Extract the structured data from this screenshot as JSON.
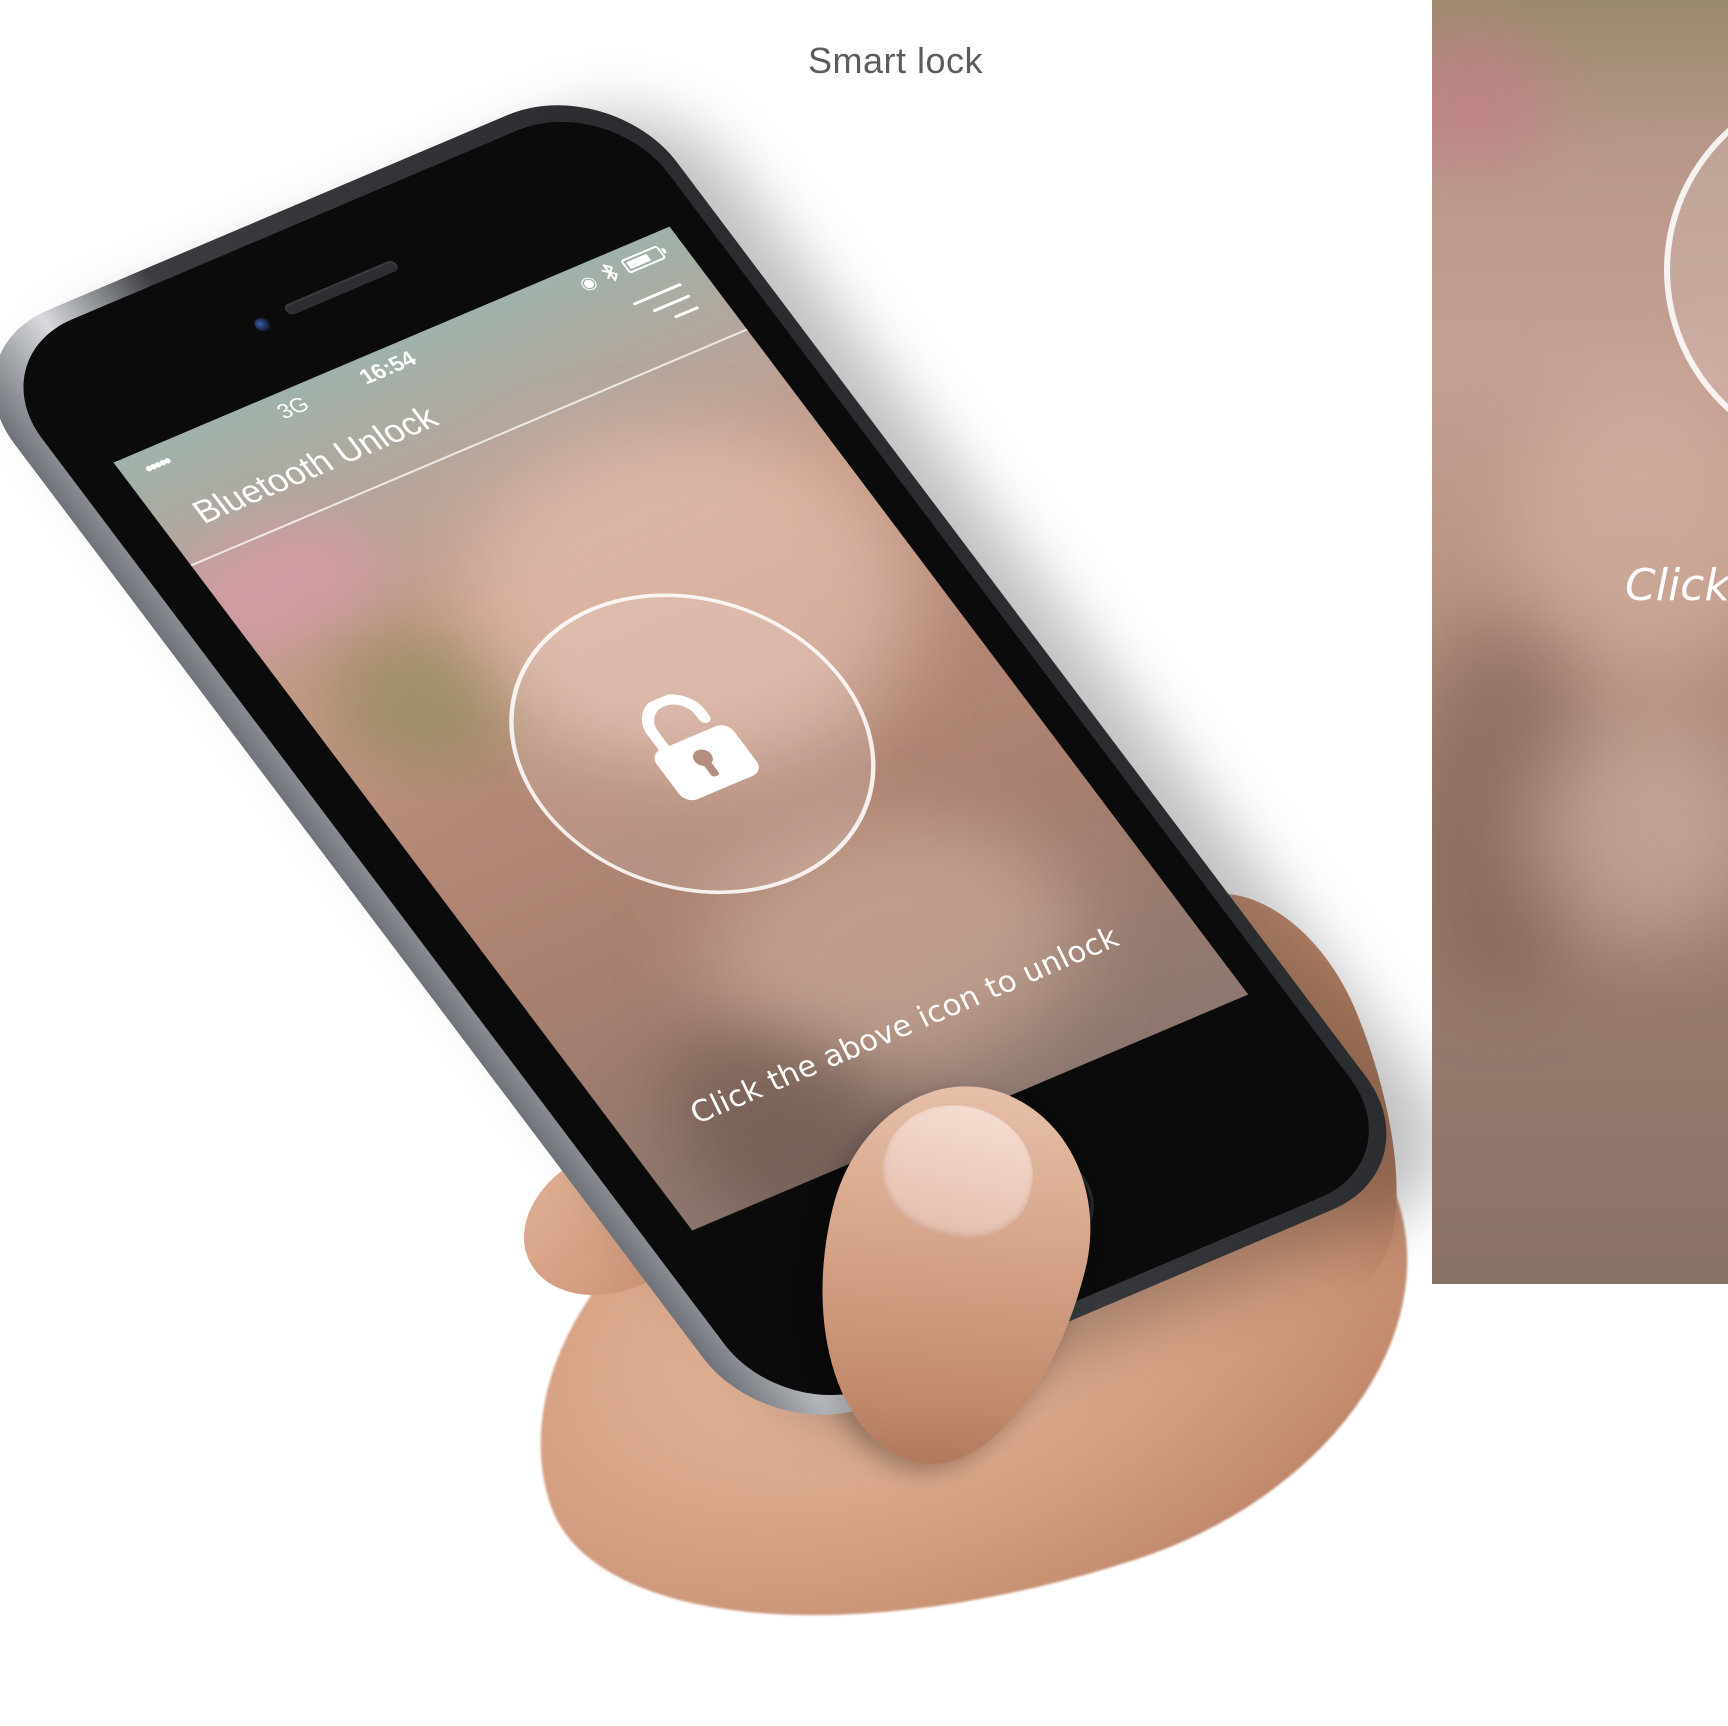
{
  "caption": "Smart lock",
  "status_bar": {
    "signal": "•••••",
    "network": "3G",
    "time": "16:54",
    "battery_level": 0.7
  },
  "nav": {
    "title": "Bluetooth Unlock"
  },
  "lock": {
    "state": "unlocked"
  },
  "hint": "Click the above icon to unlock",
  "zoom_panel": {
    "hint_fragment": "Click"
  },
  "colors": {
    "accent": "#ffffff",
    "caption": "#5c5c5c"
  }
}
